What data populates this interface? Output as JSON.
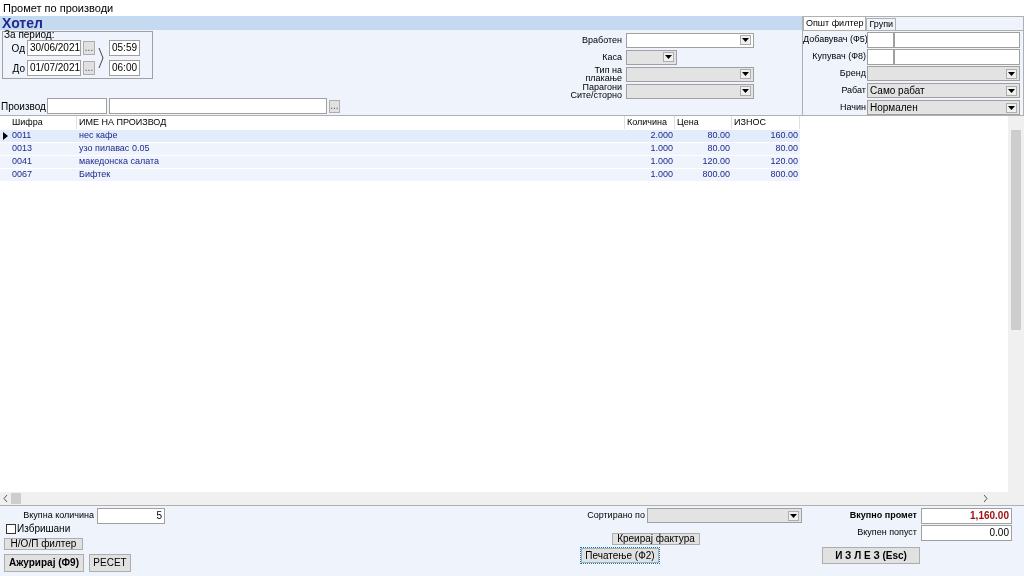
{
  "window": {
    "title": "Промет по производи"
  },
  "header": {
    "title": "Хотел"
  },
  "period": {
    "label": "За период:",
    "rows": [
      {
        "label": "Од",
        "date": "30/06/2021",
        "button": "...",
        "time": "05:59"
      },
      {
        "label": "До",
        "date": "01/07/2021",
        "button": "...",
        "time": "06:00"
      }
    ]
  },
  "product": {
    "label": "Производ",
    "button": "..."
  },
  "filters": [
    {
      "kind": "combo",
      "label": "Вработен",
      "disabled": false
    },
    {
      "kind": "short_combo",
      "label": "Каса",
      "disabled": true
    },
    {
      "kind": "combo",
      "label": "Тип на\nплакање",
      "disabled": true
    },
    {
      "kind": "combo",
      "label": "Парагони\nСите/сторно",
      "disabled": true
    }
  ],
  "filter_panel": {
    "tabs": [
      {
        "label": "Општ филтер",
        "selected": true
      },
      {
        "label": "Групи",
        "selected": false
      }
    ],
    "fields": [
      {
        "kind": "code_name",
        "label": "Добавувач (Ф5)"
      },
      {
        "kind": "code_name",
        "label": "Купувач (Ф8)"
      },
      {
        "kind": "combo",
        "label": "Бренд"
      },
      {
        "kind": "combo",
        "label": "Рабат",
        "value": "Само рабат"
      },
      {
        "kind": "combo",
        "label": "Начин",
        "value": "Нормален"
      }
    ]
  },
  "table": {
    "columns": [
      "Шифра",
      "ИМЕ НА ПРОИЗВОД",
      "Количина",
      "Цена",
      "ИЗНОС"
    ],
    "rows": [
      {
        "selected": true,
        "cells": [
          "0011",
          "нес кафе",
          "2.000",
          "80.00",
          "160.00"
        ]
      },
      {
        "selected": false,
        "cells": [
          "0013",
          "узо пилавас 0.05",
          "1.000",
          "80.00",
          "80.00"
        ]
      },
      {
        "selected": false,
        "cells": [
          "0041",
          "македонска салата",
          "1.000",
          "120.00",
          "120.00"
        ]
      },
      {
        "selected": false,
        "cells": [
          "0067",
          "Бифтек",
          "1.000",
          "800.00",
          "800.00"
        ]
      }
    ]
  },
  "footer": {
    "total_quantity": {
      "label": "Вкупна количина",
      "value": "5"
    },
    "deleted": {
      "label": "Избришани",
      "checked": false
    },
    "filter_button": "Н/О/П филтер",
    "update_button": "Ажурирај (Ф9)",
    "reset_button": "РЕСЕТ",
    "sort": {
      "label": "Сортирано по"
    },
    "invoice_button": "Креирај фактура",
    "print_button": "Печатење (Ф2)",
    "total_turnover": {
      "label": "Вкупно промет",
      "value": "1,160.00"
    },
    "total_discount": {
      "label": "Вкупен попуст",
      "value": "0.00"
    },
    "exit_button": "И З Л Е З (Esc)"
  }
}
